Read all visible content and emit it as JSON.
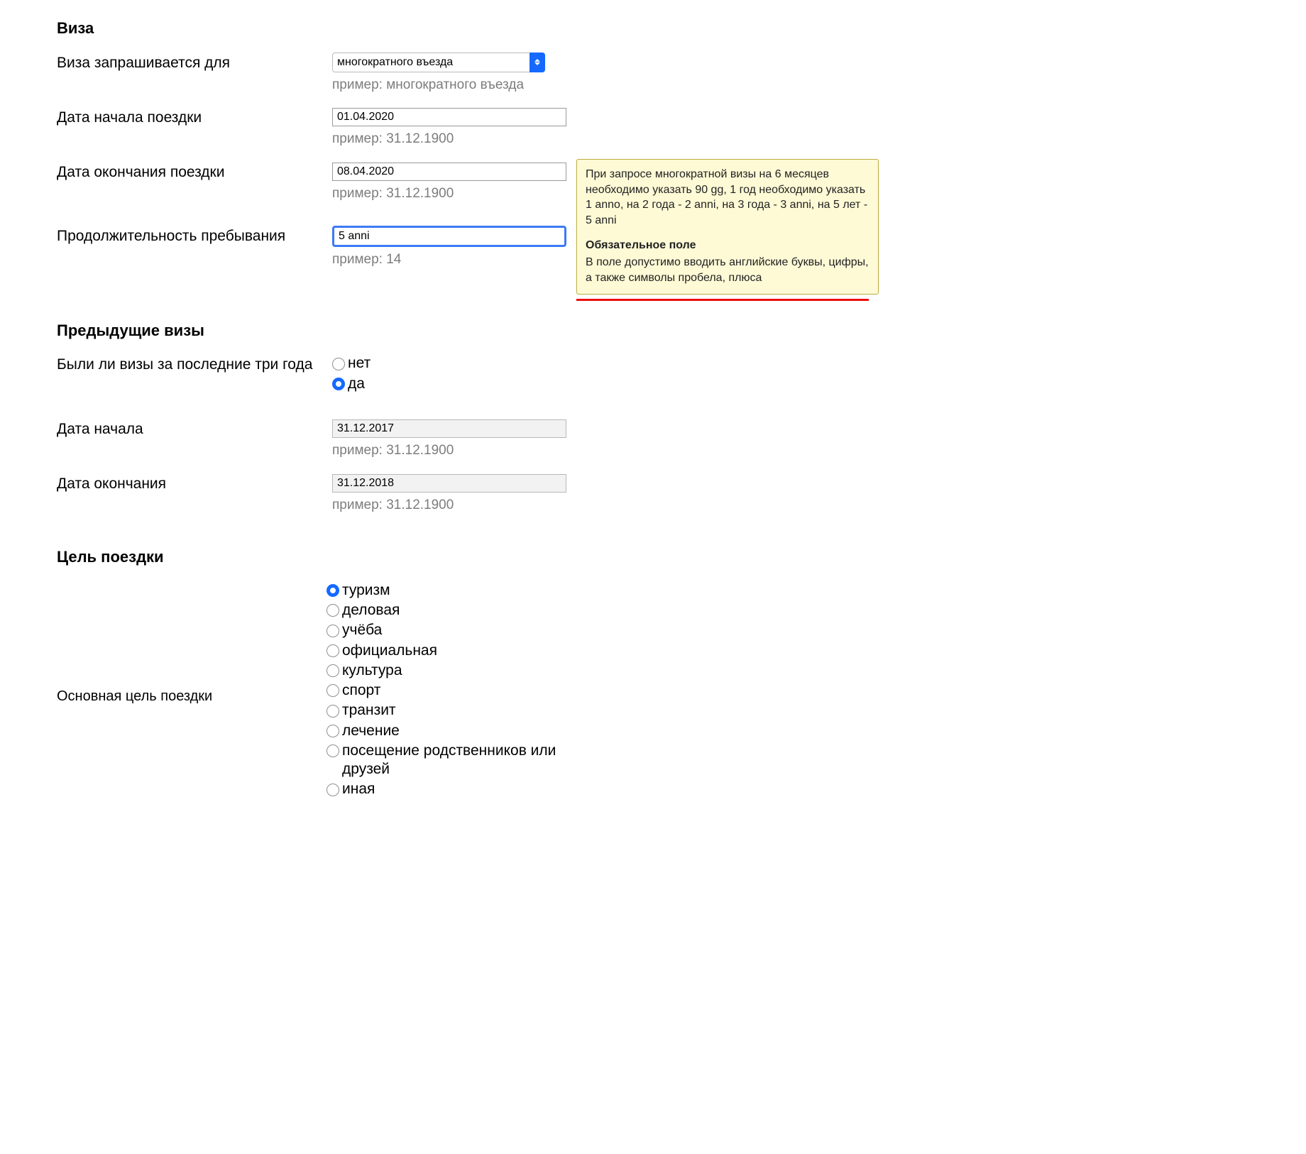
{
  "section_visa_title": "Виза",
  "visa_for": {
    "label": "Виза запрашивается для",
    "value": "многократного въезда",
    "hint": "пример: многократного въезда"
  },
  "start_date": {
    "label": "Дата начала поездки",
    "value": "01.04.2020",
    "hint": "пример: 31.12.1900"
  },
  "end_date": {
    "label": "Дата окончания поездки",
    "value": "08.04.2020",
    "hint": "пример: 31.12.1900"
  },
  "duration": {
    "label": "Продолжительность пребывания",
    "value": "5 anni",
    "hint": "пример: 14"
  },
  "tooltip": {
    "p1": "При запросе многократной визы на 6 месяцев необходимо указать 90 gg, 1 год необходимо указать 1 anno, на 2 года - 2 anni, на 3 года - 3 anni, на 5 лет - 5 anni",
    "req_title": "Обязательное поле",
    "p2": "В поле допустимо вводить английские буквы, цифры, а также символы пробела, плюса"
  },
  "section_prev_title": "Предыдущие визы",
  "prev_question": {
    "label": "Были ли визы за последние три года",
    "no": "нет",
    "yes": "да",
    "selected": "yes"
  },
  "prev_start": {
    "label": "Дата начала",
    "value": "31.12.2017",
    "hint": "пример: 31.12.1900"
  },
  "prev_end": {
    "label": "Дата окончания",
    "value": "31.12.2018",
    "hint": "пример: 31.12.1900"
  },
  "section_purpose_title": "Цель поездки",
  "purpose": {
    "label": "Основная цель поездки",
    "selected": "tourism",
    "options": {
      "tourism": "туризм",
      "business": "деловая",
      "study": "учёба",
      "official": "официальная",
      "culture": "культура",
      "sport": "спорт",
      "transit": "транзит",
      "medical": "лечение",
      "relatives": "посещение родственников или друзей",
      "other": "иная"
    }
  }
}
